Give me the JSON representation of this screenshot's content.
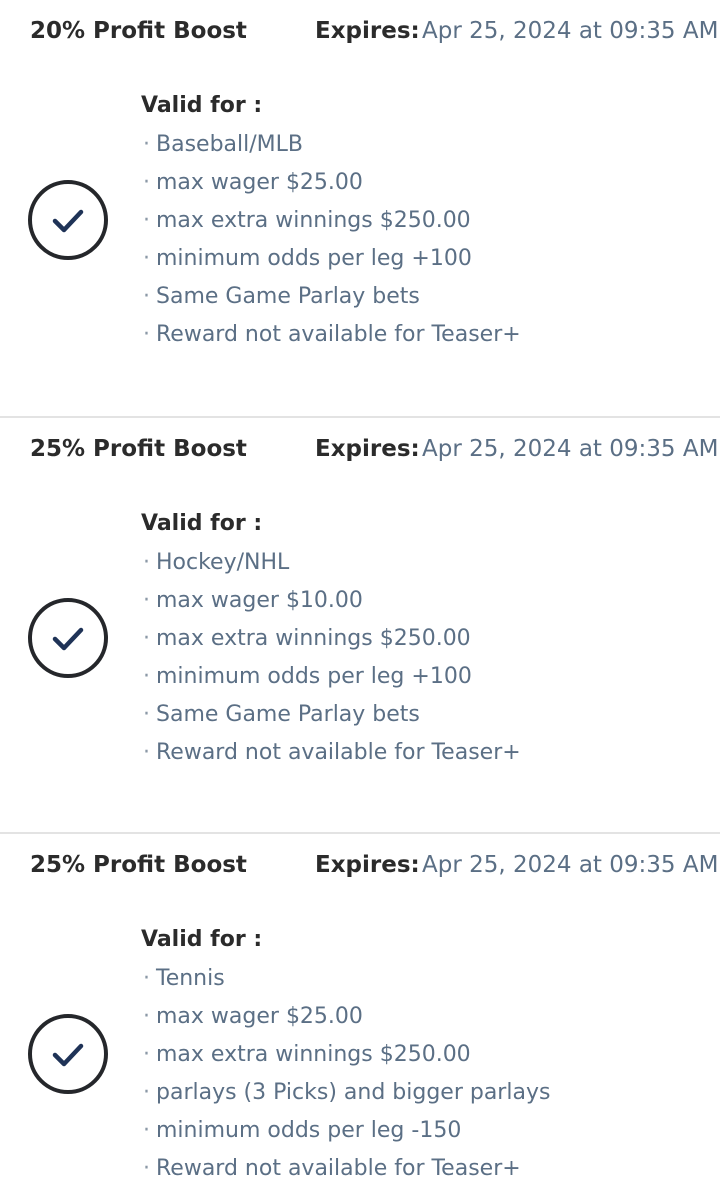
{
  "colors": {
    "heading": "#2b2b2b",
    "detail_text": "#5b6f85",
    "check_icon": "#1f3357",
    "divider": "#e3e3e3"
  },
  "offers": [
    {
      "title": "20% Profit Boost",
      "expires_label": "Expires:",
      "expires_value": "Apr 25, 2024 at 09:35 AM",
      "selected_icon": "check-circle-icon",
      "valid_for_label": "Valid for :",
      "items": [
        "Baseball/MLB",
        "max wager $25.00",
        "max extra winnings $250.00",
        "minimum odds per leg +100",
        "Same Game Parlay bets",
        "Reward not available for Teaser+"
      ]
    },
    {
      "title": "25% Profit Boost",
      "expires_label": "Expires:",
      "expires_value": "Apr 25, 2024 at 09:35 AM",
      "selected_icon": "check-circle-icon",
      "valid_for_label": "Valid for :",
      "items": [
        "Hockey/NHL",
        "max wager $10.00",
        "max extra winnings $250.00",
        "minimum odds per leg +100",
        "Same Game Parlay bets",
        "Reward not available for Teaser+"
      ]
    },
    {
      "title": "25% Profit Boost",
      "expires_label": "Expires:",
      "expires_value": "Apr 25, 2024 at 09:35 AM",
      "selected_icon": "check-circle-icon",
      "valid_for_label": "Valid for :",
      "items": [
        "Tennis",
        "max wager $25.00",
        "max extra winnings $250.00",
        "parlays (3 Picks) and bigger parlays",
        "minimum odds per leg -150",
        "Reward not available for Teaser+"
      ]
    }
  ]
}
